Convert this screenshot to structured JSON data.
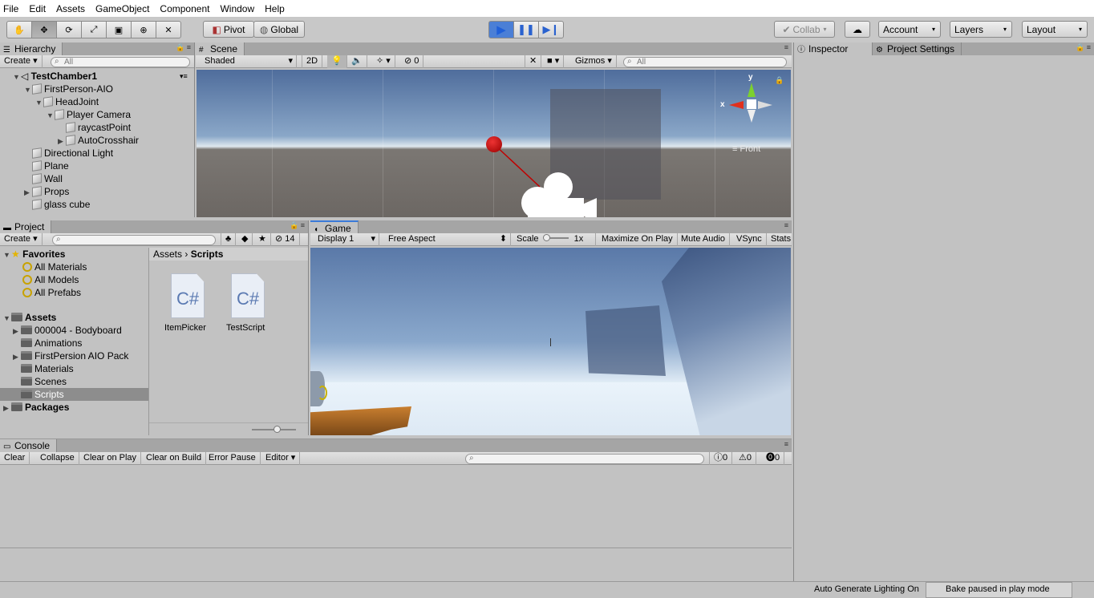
{
  "menu": [
    "File",
    "Edit",
    "Assets",
    "GameObject",
    "Component",
    "Window",
    "Help"
  ],
  "toolbar": {
    "pivot": "Pivot",
    "global": "Global",
    "collab": "Collab",
    "account": "Account",
    "layers": "Layers",
    "layout": "Layout"
  },
  "hierarchy": {
    "tab": "Hierarchy",
    "create": "Create",
    "search_placeholder": "All",
    "scene": "TestChamber1",
    "items": [
      "FirstPerson-AIO",
      "HeadJoint",
      "Player Camera",
      "raycastPoint",
      "AutoCrosshair",
      "Directional Light",
      "Plane",
      "Wall",
      "Props",
      "glass cube"
    ]
  },
  "scene": {
    "tab": "Scene",
    "shading": "Shaded",
    "mode_2d": "2D",
    "hidden_count": "0",
    "gizmos": "Gizmos",
    "search_placeholder": "All",
    "axis_y": "y",
    "axis_x": "x",
    "view": "Front"
  },
  "project": {
    "tab": "Project",
    "create": "Create",
    "hidden_count": "14",
    "favorites": "Favorites",
    "fav_items": [
      "All Materials",
      "All Models",
      "All Prefabs"
    ],
    "assets": "Assets",
    "asset_folders": [
      "000004 - Bodyboard",
      "Animations",
      "FirstPersion AIO Pack",
      "Materials",
      "Scenes",
      "Scripts"
    ],
    "packages": "Packages",
    "breadcrumb": [
      "Assets",
      "Scripts"
    ],
    "files": [
      {
        "icon": "C#",
        "name": "ItemPicker"
      },
      {
        "icon": "C#",
        "name": "TestScript"
      }
    ]
  },
  "game": {
    "tab": "Game",
    "display": "Display 1",
    "aspect": "Free Aspect",
    "scale_label": "Scale",
    "scale_value": "1x",
    "maximize": "Maximize On Play",
    "mute": "Mute Audio",
    "vsync": "VSync",
    "stats": "Stats"
  },
  "console": {
    "tab": "Console",
    "clear": "Clear",
    "collapse": "Collapse",
    "clear_on_play": "Clear on Play",
    "clear_on_build": "Clear on Build",
    "error_pause": "Error Pause",
    "editor": "Editor",
    "logs": "0",
    "warnings": "0",
    "errors": "0"
  },
  "inspector": {
    "tab": "Inspector",
    "settings_tab": "Project Settings"
  },
  "status": {
    "lighting": "Auto Generate Lighting On",
    "bake": "Bake paused in play mode"
  },
  "colors": {
    "play_active": "#4b7fd6",
    "selection": "#8d8d8d"
  }
}
